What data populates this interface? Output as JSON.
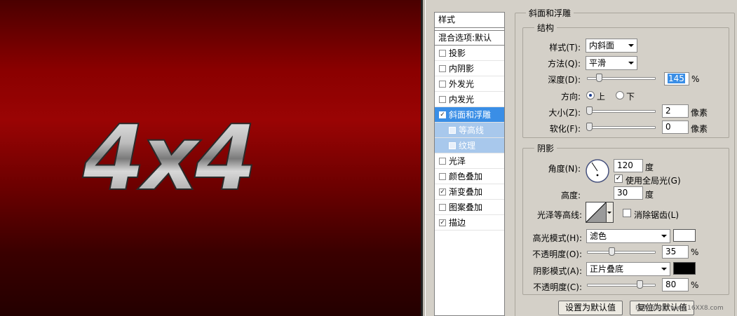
{
  "canvas": {
    "logo_text": "4x4"
  },
  "style_list": {
    "header": "样式",
    "blend_options": "混合选项:默认",
    "items": [
      {
        "label": "投影",
        "checked": false,
        "state": "normal"
      },
      {
        "label": "内阴影",
        "checked": false,
        "state": "normal"
      },
      {
        "label": "外发光",
        "checked": false,
        "state": "normal"
      },
      {
        "label": "内发光",
        "checked": false,
        "state": "normal"
      },
      {
        "label": "斜面和浮雕",
        "checked": true,
        "state": "active"
      },
      {
        "label": "等高线",
        "checked": false,
        "state": "sub"
      },
      {
        "label": "纹理",
        "checked": false,
        "state": "sub"
      },
      {
        "label": "光泽",
        "checked": false,
        "state": "normal"
      },
      {
        "label": "颜色叠加",
        "checked": false,
        "state": "normal"
      },
      {
        "label": "渐变叠加",
        "checked": true,
        "state": "normal"
      },
      {
        "label": "图案叠加",
        "checked": false,
        "state": "normal"
      },
      {
        "label": "描边",
        "checked": true,
        "state": "normal"
      }
    ]
  },
  "bevel": {
    "title": "斜面和浮雕",
    "structure": {
      "title": "结构",
      "style_label": "样式(T):",
      "style_value": "内斜面",
      "technique_label": "方法(Q):",
      "technique_value": "平滑",
      "depth_label": "深度(D):",
      "depth_value": "145",
      "depth_unit": "%",
      "depth_fraction": 0.145,
      "direction_label": "方向:",
      "direction_up": "上",
      "direction_down": "下",
      "direction_selected": "up",
      "size_label": "大小(Z):",
      "size_value": "2",
      "size_unit": "像素",
      "soften_label": "软化(F):",
      "soften_value": "0",
      "soften_unit": "像素"
    },
    "shading": {
      "title": "阴影",
      "angle_label": "角度(N):",
      "angle_value": "120",
      "angle_unit": "度",
      "global_light_label": "使用全局光(G)",
      "global_light_checked": true,
      "altitude_label": "高度:",
      "altitude_value": "30",
      "altitude_unit": "度",
      "gloss_contour_label": "光泽等高线:",
      "antialias_label": "消除锯齿(L)",
      "antialias_checked": false,
      "highlight_mode_label": "高光模式(H):",
      "highlight_mode_value": "滤色",
      "highlight_color": "#ffffff",
      "highlight_opacity_label": "不透明度(O):",
      "highlight_opacity_value": "35",
      "highlight_opacity_unit": "%",
      "shadow_mode_label": "阴影模式(A):",
      "shadow_mode_value": "正片叠底",
      "shadow_color": "#000000",
      "shadow_opacity_label": "不透明度(C):",
      "shadow_opacity_value": "80",
      "shadow_opacity_unit": "%"
    },
    "buttons": {
      "make_default": "设置为默认值",
      "reset_default": "复位为默认值"
    }
  },
  "watermark": "PS教程论坛 www.16XX8.com"
}
